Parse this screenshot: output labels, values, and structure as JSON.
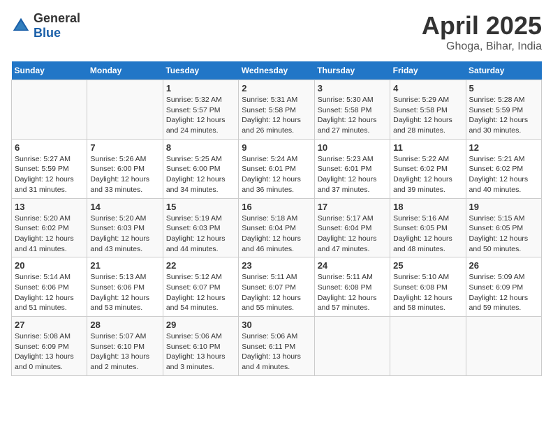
{
  "header": {
    "logo_general": "General",
    "logo_blue": "Blue",
    "month": "April 2025",
    "location": "Ghoga, Bihar, India"
  },
  "weekdays": [
    "Sunday",
    "Monday",
    "Tuesday",
    "Wednesday",
    "Thursday",
    "Friday",
    "Saturday"
  ],
  "weeks": [
    [
      {
        "day": null
      },
      {
        "day": null
      },
      {
        "day": "1",
        "sunrise": "5:32 AM",
        "sunset": "5:57 PM",
        "daylight": "12 hours and 24 minutes."
      },
      {
        "day": "2",
        "sunrise": "5:31 AM",
        "sunset": "5:58 PM",
        "daylight": "12 hours and 26 minutes."
      },
      {
        "day": "3",
        "sunrise": "5:30 AM",
        "sunset": "5:58 PM",
        "daylight": "12 hours and 27 minutes."
      },
      {
        "day": "4",
        "sunrise": "5:29 AM",
        "sunset": "5:58 PM",
        "daylight": "12 hours and 28 minutes."
      },
      {
        "day": "5",
        "sunrise": "5:28 AM",
        "sunset": "5:59 PM",
        "daylight": "12 hours and 30 minutes."
      }
    ],
    [
      {
        "day": "6",
        "sunrise": "5:27 AM",
        "sunset": "5:59 PM",
        "daylight": "12 hours and 31 minutes."
      },
      {
        "day": "7",
        "sunrise": "5:26 AM",
        "sunset": "6:00 PM",
        "daylight": "12 hours and 33 minutes."
      },
      {
        "day": "8",
        "sunrise": "5:25 AM",
        "sunset": "6:00 PM",
        "daylight": "12 hours and 34 minutes."
      },
      {
        "day": "9",
        "sunrise": "5:24 AM",
        "sunset": "6:01 PM",
        "daylight": "12 hours and 36 minutes."
      },
      {
        "day": "10",
        "sunrise": "5:23 AM",
        "sunset": "6:01 PM",
        "daylight": "12 hours and 37 minutes."
      },
      {
        "day": "11",
        "sunrise": "5:22 AM",
        "sunset": "6:02 PM",
        "daylight": "12 hours and 39 minutes."
      },
      {
        "day": "12",
        "sunrise": "5:21 AM",
        "sunset": "6:02 PM",
        "daylight": "12 hours and 40 minutes."
      }
    ],
    [
      {
        "day": "13",
        "sunrise": "5:20 AM",
        "sunset": "6:02 PM",
        "daylight": "12 hours and 41 minutes."
      },
      {
        "day": "14",
        "sunrise": "5:20 AM",
        "sunset": "6:03 PM",
        "daylight": "12 hours and 43 minutes."
      },
      {
        "day": "15",
        "sunrise": "5:19 AM",
        "sunset": "6:03 PM",
        "daylight": "12 hours and 44 minutes."
      },
      {
        "day": "16",
        "sunrise": "5:18 AM",
        "sunset": "6:04 PM",
        "daylight": "12 hours and 46 minutes."
      },
      {
        "day": "17",
        "sunrise": "5:17 AM",
        "sunset": "6:04 PM",
        "daylight": "12 hours and 47 minutes."
      },
      {
        "day": "18",
        "sunrise": "5:16 AM",
        "sunset": "6:05 PM",
        "daylight": "12 hours and 48 minutes."
      },
      {
        "day": "19",
        "sunrise": "5:15 AM",
        "sunset": "6:05 PM",
        "daylight": "12 hours and 50 minutes."
      }
    ],
    [
      {
        "day": "20",
        "sunrise": "5:14 AM",
        "sunset": "6:06 PM",
        "daylight": "12 hours and 51 minutes."
      },
      {
        "day": "21",
        "sunrise": "5:13 AM",
        "sunset": "6:06 PM",
        "daylight": "12 hours and 53 minutes."
      },
      {
        "day": "22",
        "sunrise": "5:12 AM",
        "sunset": "6:07 PM",
        "daylight": "12 hours and 54 minutes."
      },
      {
        "day": "23",
        "sunrise": "5:11 AM",
        "sunset": "6:07 PM",
        "daylight": "12 hours and 55 minutes."
      },
      {
        "day": "24",
        "sunrise": "5:11 AM",
        "sunset": "6:08 PM",
        "daylight": "12 hours and 57 minutes."
      },
      {
        "day": "25",
        "sunrise": "5:10 AM",
        "sunset": "6:08 PM",
        "daylight": "12 hours and 58 minutes."
      },
      {
        "day": "26",
        "sunrise": "5:09 AM",
        "sunset": "6:09 PM",
        "daylight": "12 hours and 59 minutes."
      }
    ],
    [
      {
        "day": "27",
        "sunrise": "5:08 AM",
        "sunset": "6:09 PM",
        "daylight": "13 hours and 0 minutes."
      },
      {
        "day": "28",
        "sunrise": "5:07 AM",
        "sunset": "6:10 PM",
        "daylight": "13 hours and 2 minutes."
      },
      {
        "day": "29",
        "sunrise": "5:06 AM",
        "sunset": "6:10 PM",
        "daylight": "13 hours and 3 minutes."
      },
      {
        "day": "30",
        "sunrise": "5:06 AM",
        "sunset": "6:11 PM",
        "daylight": "13 hours and 4 minutes."
      },
      {
        "day": null
      },
      {
        "day": null
      },
      {
        "day": null
      }
    ]
  ]
}
